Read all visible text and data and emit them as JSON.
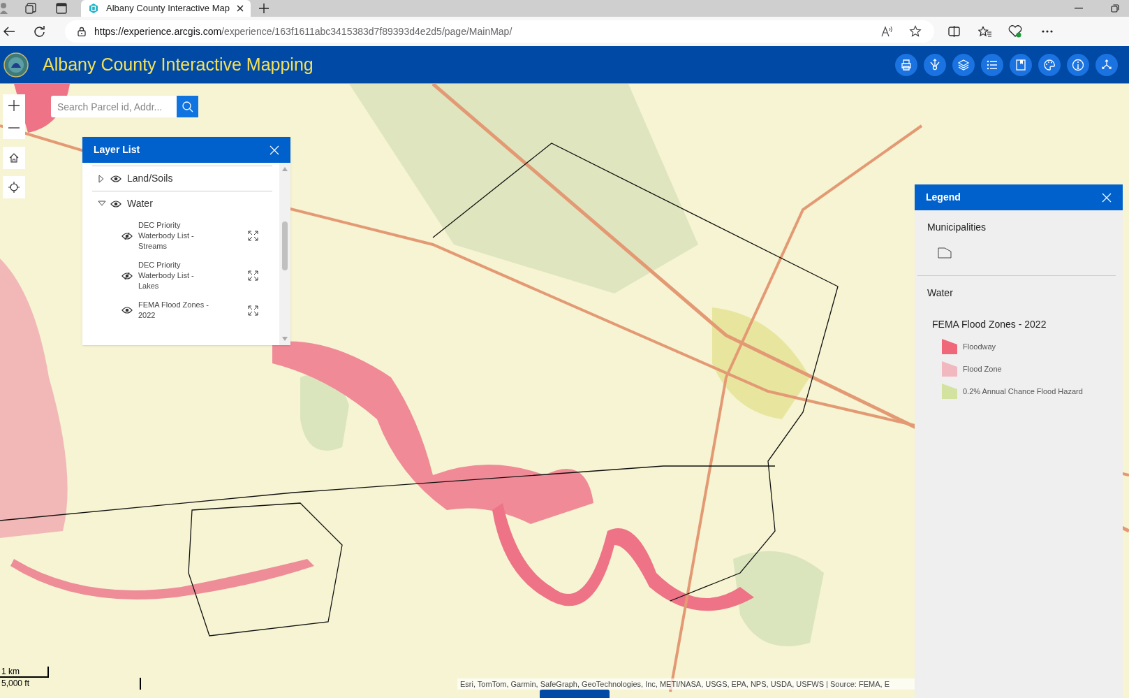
{
  "browser": {
    "tab_title": "Albany County Interactive Map",
    "url_host": "https://experience.arcgis.com",
    "url_path": "/experience/163f1611abc3415383d7f89393d4e2d5/page/MainMap/"
  },
  "app": {
    "title": "Albany County Interactive Mapping",
    "toolbar": [
      {
        "kind": "print"
      },
      {
        "kind": "analysis"
      },
      {
        "kind": "layers"
      },
      {
        "kind": "list"
      },
      {
        "kind": "bookmark"
      },
      {
        "kind": "palette"
      },
      {
        "kind": "info"
      },
      {
        "kind": "share"
      }
    ]
  },
  "map": {
    "kind": "picture",
    "search": {
      "placeholder": "Search Parcel id, Addr..."
    },
    "attribution": "Esri, TomTom, Garmin, SafeGraph, GeoTechnologies, Inc, METI/NASA, USGS, EPA, NPS, USDA, USFWS | Source: FEMA, E",
    "scale": {
      "metric": "1 km",
      "imperial": "5,000 ft"
    }
  },
  "layer_list": {
    "title": "Layer List",
    "layers": [
      {
        "label": "Land/Soils",
        "expanded": false,
        "visible": true
      },
      {
        "label": "Water",
        "expanded": true,
        "visible": true,
        "children": [
          {
            "label": "DEC Priority Waterbody List - Streams",
            "in_scale": false
          },
          {
            "label": "DEC Priority Waterbody List - Lakes",
            "in_scale": false
          },
          {
            "label": "FEMA Flood Zones - 2022",
            "in_scale": true
          }
        ]
      }
    ]
  },
  "legend": {
    "title": "Legend",
    "sections": [
      {
        "title": "Municipalities",
        "kind": "outline"
      },
      {
        "title": "Water",
        "kind": "group",
        "layer": "FEMA Flood Zones - 2022",
        "items": [
          {
            "label": "Floodway",
            "color": "#f0677a"
          },
          {
            "label": "Flood Zone",
            "color": "#f2b8bf"
          },
          {
            "label": "0.2% Annual Chance Flood Hazard",
            "color": "#d4e2a0"
          }
        ]
      }
    ]
  }
}
